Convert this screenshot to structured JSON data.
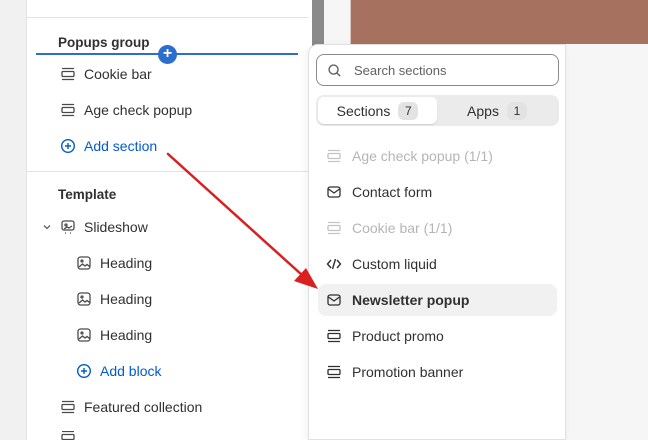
{
  "sidebar": {
    "popups_group": {
      "title": "Popups group",
      "items": [
        {
          "label": "Cookie bar",
          "icon": "section-icon"
        },
        {
          "label": "Age check popup",
          "icon": "section-icon"
        }
      ],
      "add_label": "Add section"
    },
    "template": {
      "title": "Template",
      "slideshow": {
        "label": "Slideshow",
        "icon": "slideshow-icon"
      },
      "blocks": [
        {
          "label": "Heading",
          "icon": "image-icon"
        },
        {
          "label": "Heading",
          "icon": "image-icon"
        },
        {
          "label": "Heading",
          "icon": "image-icon"
        }
      ],
      "add_block_label": "Add block",
      "featured": {
        "label": "Featured collection",
        "icon": "section-icon"
      }
    }
  },
  "picker": {
    "search_placeholder": "Search sections",
    "tabs": [
      {
        "label": "Sections",
        "count": "7",
        "active": true
      },
      {
        "label": "Apps",
        "count": "1",
        "active": false
      }
    ],
    "options": [
      {
        "label": "Age check popup (1/1)",
        "icon": "section-icon",
        "disabled": true
      },
      {
        "label": "Contact form",
        "icon": "mail-icon",
        "disabled": false
      },
      {
        "label": "Cookie bar (1/1)",
        "icon": "section-icon",
        "disabled": true
      },
      {
        "label": "Custom liquid",
        "icon": "code-icon",
        "disabled": false
      },
      {
        "label": "Newsletter popup",
        "icon": "mail-icon",
        "disabled": false,
        "hovered": true
      },
      {
        "label": "Product promo",
        "icon": "section-icon",
        "disabled": false
      },
      {
        "label": "Promotion banner",
        "icon": "section-icon",
        "disabled": false
      }
    ]
  },
  "colors": {
    "accent": "#005bd3",
    "arrow": "#d92020",
    "preview": "#a7715f"
  }
}
